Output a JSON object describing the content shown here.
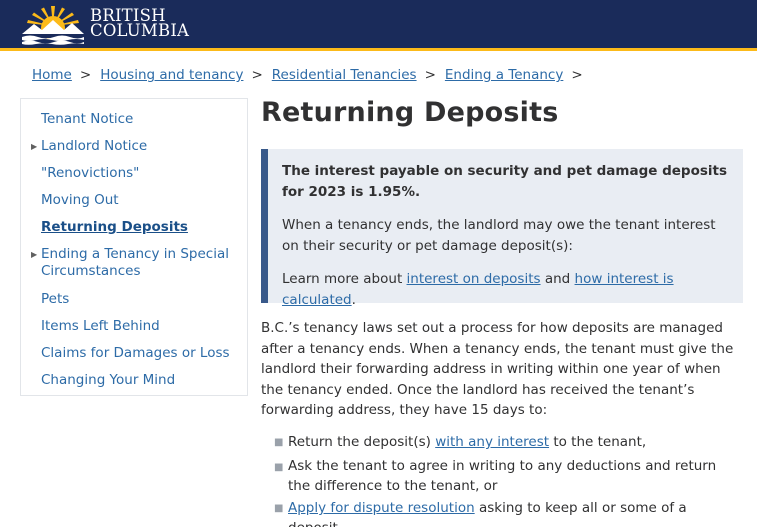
{
  "header": {
    "logo_line1": "BRITISH",
    "logo_line2": "COLUMBIA"
  },
  "breadcrumb": [
    "Home",
    "Housing and tenancy",
    "Residential Tenancies",
    "Ending a Tenancy"
  ],
  "sidebar": {
    "items": [
      {
        "label": "Tenant Notice"
      },
      {
        "label": "Landlord Notice"
      },
      {
        "label": "\"Renovictions\""
      },
      {
        "label": "Moving Out"
      },
      {
        "label": "Returning Deposits"
      },
      {
        "label": "Ending a Tenancy in Special Circumstances"
      },
      {
        "label": "Pets"
      },
      {
        "label": "Items Left Behind"
      },
      {
        "label": "Claims for Damages or Loss"
      },
      {
        "label": "Changing Your Mind"
      }
    ]
  },
  "main": {
    "title": "Returning Deposits",
    "callout": {
      "bold_text": "The interest payable on security and pet damage deposits for 2023 is 1.95%.",
      "text": "When a tenancy ends, the landlord may owe the tenant interest on their security or pet damage deposit(s):",
      "learn_prefix": "Learn more about",
      "link1": "interest on deposits",
      "learn_and": "and",
      "link2": "how interest is calculated",
      "learn_suffix": "."
    },
    "paragraph": "B.C.’s tenancy laws set out a process for how deposits are managed after a tenancy ends. When a tenancy ends, the tenant must give the landlord their forwarding address in writing within one year of when the tenancy ended. Once the landlord has received the tenant’s forwarding address, they have 15 days to:",
    "bullets": {
      "b1_prefix": "Return the deposit(s)",
      "b1_link": "with any interest",
      "b1_suffix": "to the tenant,",
      "b2_text": "Ask the tenant to agree in writing to any deductions and return the difference to the tenant, or",
      "b3_link": "Apply for dispute resolution",
      "b3_suffix": "asking to keep all or some of a deposit."
    }
  },
  "colors": {
    "header_bg": "#1a2b5a",
    "accent_gold": "#fcba19",
    "link": "#2d6ba7",
    "callout_bg": "#e9edf3",
    "callout_border": "#38598a"
  }
}
